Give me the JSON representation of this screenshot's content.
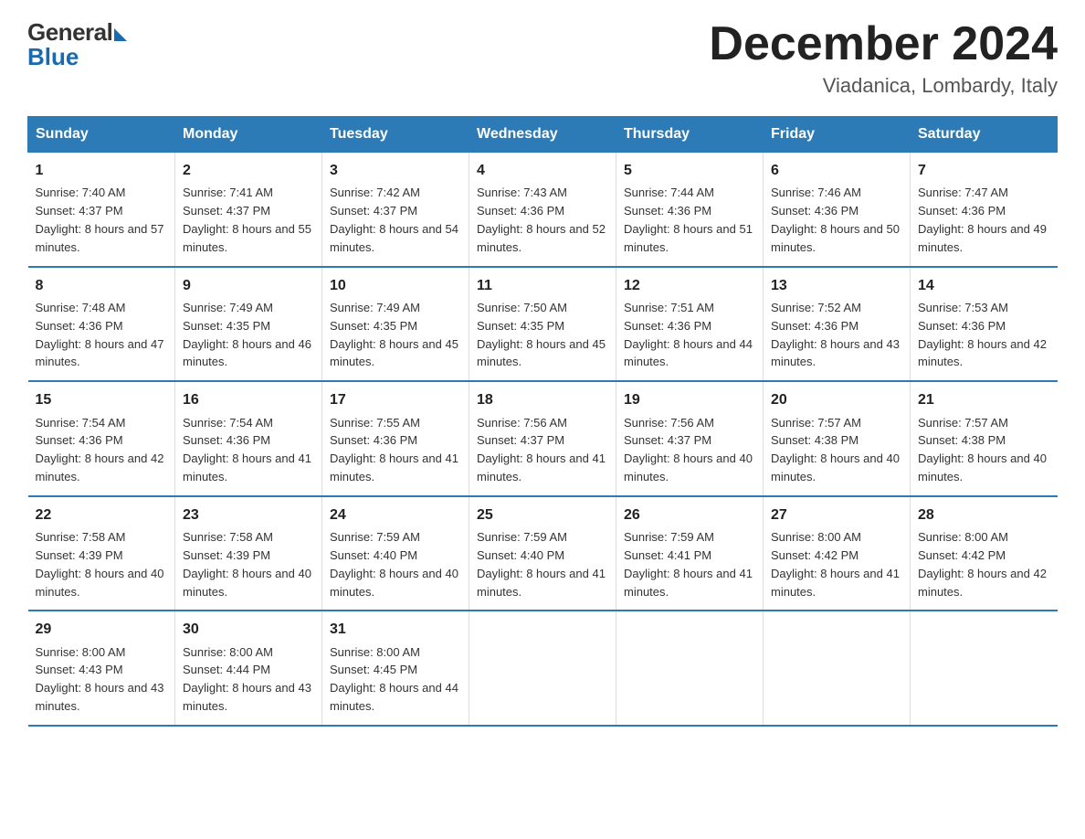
{
  "logo": {
    "general": "General",
    "blue": "Blue"
  },
  "title": {
    "month_year": "December 2024",
    "location": "Viadanica, Lombardy, Italy"
  },
  "headers": [
    "Sunday",
    "Monday",
    "Tuesday",
    "Wednesday",
    "Thursday",
    "Friday",
    "Saturday"
  ],
  "weeks": [
    [
      {
        "day": "1",
        "sunrise": "7:40 AM",
        "sunset": "4:37 PM",
        "daylight": "8 hours and 57 minutes."
      },
      {
        "day": "2",
        "sunrise": "7:41 AM",
        "sunset": "4:37 PM",
        "daylight": "8 hours and 55 minutes."
      },
      {
        "day": "3",
        "sunrise": "7:42 AM",
        "sunset": "4:37 PM",
        "daylight": "8 hours and 54 minutes."
      },
      {
        "day": "4",
        "sunrise": "7:43 AM",
        "sunset": "4:36 PM",
        "daylight": "8 hours and 52 minutes."
      },
      {
        "day": "5",
        "sunrise": "7:44 AM",
        "sunset": "4:36 PM",
        "daylight": "8 hours and 51 minutes."
      },
      {
        "day": "6",
        "sunrise": "7:46 AM",
        "sunset": "4:36 PM",
        "daylight": "8 hours and 50 minutes."
      },
      {
        "day": "7",
        "sunrise": "7:47 AM",
        "sunset": "4:36 PM",
        "daylight": "8 hours and 49 minutes."
      }
    ],
    [
      {
        "day": "8",
        "sunrise": "7:48 AM",
        "sunset": "4:36 PM",
        "daylight": "8 hours and 47 minutes."
      },
      {
        "day": "9",
        "sunrise": "7:49 AM",
        "sunset": "4:35 PM",
        "daylight": "8 hours and 46 minutes."
      },
      {
        "day": "10",
        "sunrise": "7:49 AM",
        "sunset": "4:35 PM",
        "daylight": "8 hours and 45 minutes."
      },
      {
        "day": "11",
        "sunrise": "7:50 AM",
        "sunset": "4:35 PM",
        "daylight": "8 hours and 45 minutes."
      },
      {
        "day": "12",
        "sunrise": "7:51 AM",
        "sunset": "4:36 PM",
        "daylight": "8 hours and 44 minutes."
      },
      {
        "day": "13",
        "sunrise": "7:52 AM",
        "sunset": "4:36 PM",
        "daylight": "8 hours and 43 minutes."
      },
      {
        "day": "14",
        "sunrise": "7:53 AM",
        "sunset": "4:36 PM",
        "daylight": "8 hours and 42 minutes."
      }
    ],
    [
      {
        "day": "15",
        "sunrise": "7:54 AM",
        "sunset": "4:36 PM",
        "daylight": "8 hours and 42 minutes."
      },
      {
        "day": "16",
        "sunrise": "7:54 AM",
        "sunset": "4:36 PM",
        "daylight": "8 hours and 41 minutes."
      },
      {
        "day": "17",
        "sunrise": "7:55 AM",
        "sunset": "4:36 PM",
        "daylight": "8 hours and 41 minutes."
      },
      {
        "day": "18",
        "sunrise": "7:56 AM",
        "sunset": "4:37 PM",
        "daylight": "8 hours and 41 minutes."
      },
      {
        "day": "19",
        "sunrise": "7:56 AM",
        "sunset": "4:37 PM",
        "daylight": "8 hours and 40 minutes."
      },
      {
        "day": "20",
        "sunrise": "7:57 AM",
        "sunset": "4:38 PM",
        "daylight": "8 hours and 40 minutes."
      },
      {
        "day": "21",
        "sunrise": "7:57 AM",
        "sunset": "4:38 PM",
        "daylight": "8 hours and 40 minutes."
      }
    ],
    [
      {
        "day": "22",
        "sunrise": "7:58 AM",
        "sunset": "4:39 PM",
        "daylight": "8 hours and 40 minutes."
      },
      {
        "day": "23",
        "sunrise": "7:58 AM",
        "sunset": "4:39 PM",
        "daylight": "8 hours and 40 minutes."
      },
      {
        "day": "24",
        "sunrise": "7:59 AM",
        "sunset": "4:40 PM",
        "daylight": "8 hours and 40 minutes."
      },
      {
        "day": "25",
        "sunrise": "7:59 AM",
        "sunset": "4:40 PM",
        "daylight": "8 hours and 41 minutes."
      },
      {
        "day": "26",
        "sunrise": "7:59 AM",
        "sunset": "4:41 PM",
        "daylight": "8 hours and 41 minutes."
      },
      {
        "day": "27",
        "sunrise": "8:00 AM",
        "sunset": "4:42 PM",
        "daylight": "8 hours and 41 minutes."
      },
      {
        "day": "28",
        "sunrise": "8:00 AM",
        "sunset": "4:42 PM",
        "daylight": "8 hours and 42 minutes."
      }
    ],
    [
      {
        "day": "29",
        "sunrise": "8:00 AM",
        "sunset": "4:43 PM",
        "daylight": "8 hours and 43 minutes."
      },
      {
        "day": "30",
        "sunrise": "8:00 AM",
        "sunset": "4:44 PM",
        "daylight": "8 hours and 43 minutes."
      },
      {
        "day": "31",
        "sunrise": "8:00 AM",
        "sunset": "4:45 PM",
        "daylight": "8 hours and 44 minutes."
      },
      null,
      null,
      null,
      null
    ]
  ]
}
